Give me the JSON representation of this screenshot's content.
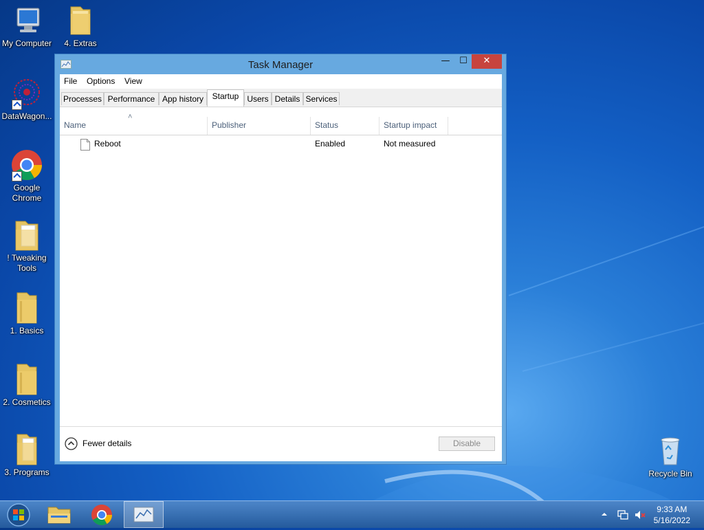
{
  "desktop": {
    "icons": [
      {
        "label": "My Computer"
      },
      {
        "label": "4. Extras"
      },
      {
        "label": "DataWagon..."
      },
      {
        "label": "Google Chrome"
      },
      {
        "label": "! Tweaking Tools"
      },
      {
        "label": "1. Basics"
      },
      {
        "label": "2. Cosmetics"
      },
      {
        "label": "3. Programs"
      },
      {
        "label": "Recycle Bin"
      }
    ]
  },
  "window": {
    "title": "Task Manager",
    "controls": {
      "minimize": "—",
      "maximize": "☐",
      "close": "✕"
    },
    "menu": [
      "File",
      "Options",
      "View"
    ],
    "tabs": [
      {
        "label": "Processes"
      },
      {
        "label": "Performance"
      },
      {
        "label": "App history"
      },
      {
        "label": "Startup",
        "active": true
      },
      {
        "label": "Users"
      },
      {
        "label": "Details"
      },
      {
        "label": "Services"
      }
    ],
    "columns": [
      "Name",
      "Publisher",
      "Status",
      "Startup impact"
    ],
    "sort_indicator": "˄",
    "rows": [
      {
        "name": "Reboot",
        "publisher": "",
        "status": "Enabled",
        "impact": "Not measured"
      }
    ],
    "footer": {
      "fewer_details": "Fewer details",
      "disable_button": "Disable"
    }
  },
  "taskbar": {
    "items": [
      "start-orb-icon",
      "file-explorer-icon",
      "chrome-icon",
      "task-manager-icon"
    ],
    "tray": {
      "time": "9:33 AM",
      "date": "5/16/2022"
    }
  },
  "colors": {
    "accent": "#67a9e0",
    "close_red": "#c7443e",
    "taskbar": "#2f6bb0"
  }
}
